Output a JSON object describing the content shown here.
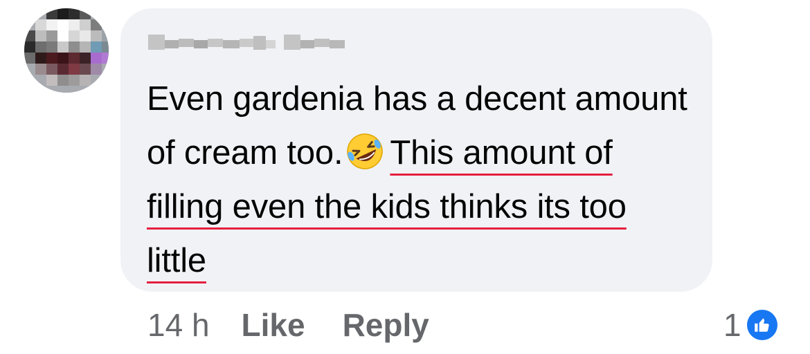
{
  "comment": {
    "author_name": "",
    "text_before_emoji": "Even gardenia has a decent amount of cream too.",
    "emoji": "rolling-on-the-floor-laughing-emoji",
    "text_after_emoji": "This amount of filling even the kids thinks its too little",
    "timestamp": "14 h",
    "like_label": "Like",
    "reply_label": "Reply",
    "reaction_count": "1",
    "reaction_type": "like-icon"
  },
  "colors": {
    "bubble": "#f0f2f5",
    "text": "#050505",
    "meta_text": "#65676b",
    "like_blue": "#1877f2",
    "spellcheck_underline": "#e41e3f"
  }
}
